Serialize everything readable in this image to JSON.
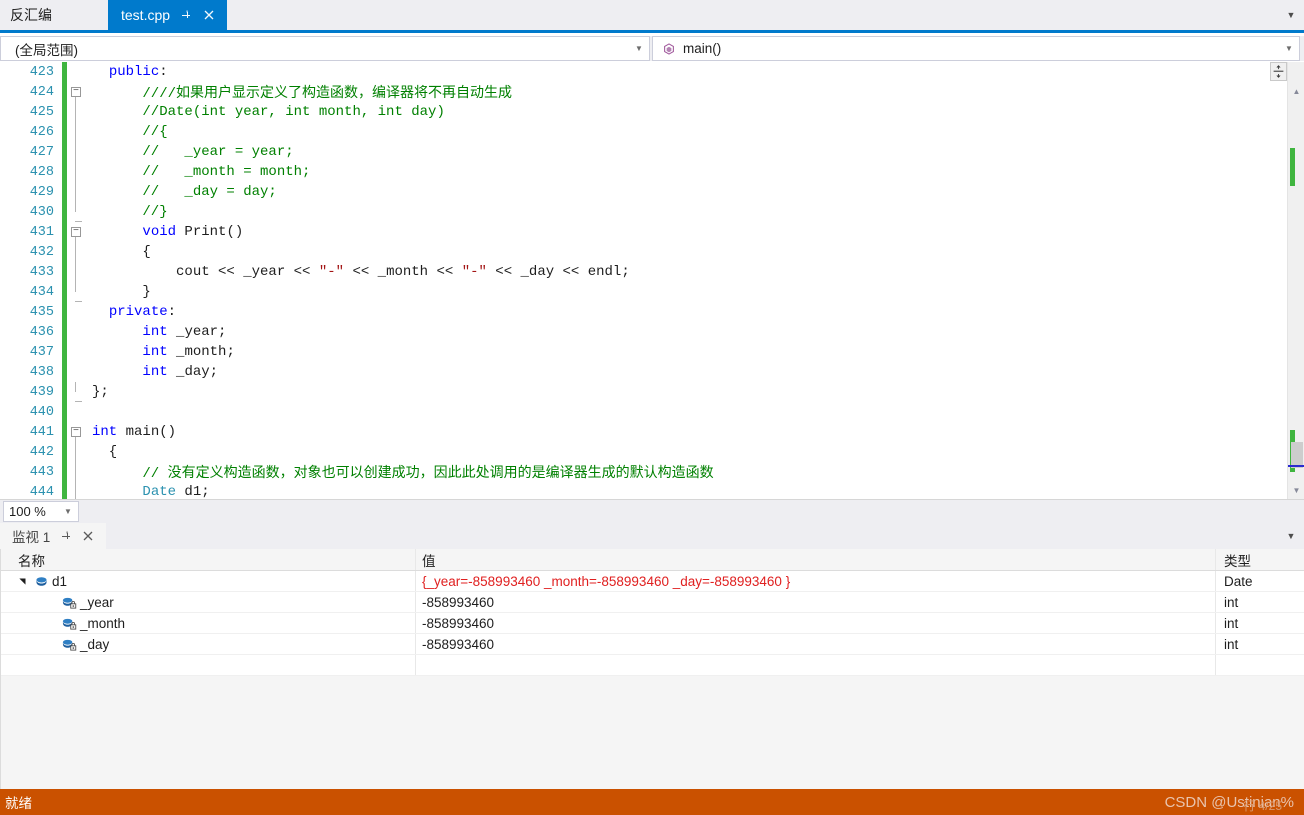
{
  "tabs": {
    "inactive_label": "反汇编",
    "active_label": "test.cpp",
    "pin_icon": "pin-icon",
    "close_icon": "close-icon",
    "overflow_icon": "chevron-down-icon"
  },
  "navbar": {
    "scope_value": "(全局范围)",
    "member_value": "main()",
    "member_icon": "method-icon",
    "caret_icon": "chevron-down-icon"
  },
  "editor": {
    "lines": [
      {
        "num": "423",
        "changed": true,
        "fold": "none",
        "segs": [
          {
            "t": "  ",
            "c": ""
          },
          {
            "t": "public",
            "c": "kw"
          },
          {
            "t": ":",
            "c": ""
          }
        ]
      },
      {
        "num": "424",
        "changed": true,
        "fold": "minus-start",
        "segs": [
          {
            "t": "      ////如果用户显示定义了构造函数，编译器将不再自动生成",
            "c": "cmt"
          }
        ]
      },
      {
        "num": "425",
        "changed": true,
        "fold": "line",
        "segs": [
          {
            "t": "      //Date(int year, int month, int day)",
            "c": "cmt"
          }
        ]
      },
      {
        "num": "426",
        "changed": true,
        "fold": "line",
        "segs": [
          {
            "t": "      //{",
            "c": "cmt"
          }
        ]
      },
      {
        "num": "427",
        "changed": true,
        "fold": "line",
        "segs": [
          {
            "t": "      //   _year = year;",
            "c": "cmt"
          }
        ]
      },
      {
        "num": "428",
        "changed": true,
        "fold": "line",
        "segs": [
          {
            "t": "      //   _month = month;",
            "c": "cmt"
          }
        ]
      },
      {
        "num": "429",
        "changed": true,
        "fold": "line",
        "segs": [
          {
            "t": "      //   _day = day;",
            "c": "cmt"
          }
        ]
      },
      {
        "num": "430",
        "changed": true,
        "fold": "line-end",
        "segs": [
          {
            "t": "      //}",
            "c": "cmt"
          }
        ]
      },
      {
        "num": "431",
        "changed": true,
        "fold": "minus-start",
        "segs": [
          {
            "t": "      ",
            "c": ""
          },
          {
            "t": "void",
            "c": "kw"
          },
          {
            "t": " Print()",
            "c": ""
          }
        ]
      },
      {
        "num": "432",
        "changed": true,
        "fold": "line",
        "segs": [
          {
            "t": "      {",
            "c": ""
          }
        ]
      },
      {
        "num": "433",
        "changed": true,
        "fold": "line",
        "segs": [
          {
            "t": "          cout << _year << ",
            "c": ""
          },
          {
            "t": "\"-\"",
            "c": "str"
          },
          {
            "t": " << _month << ",
            "c": ""
          },
          {
            "t": "\"-\"",
            "c": "str"
          },
          {
            "t": " << _day << endl;",
            "c": ""
          }
        ]
      },
      {
        "num": "434",
        "changed": true,
        "fold": "line-end",
        "segs": [
          {
            "t": "      }",
            "c": ""
          }
        ]
      },
      {
        "num": "435",
        "changed": true,
        "fold": "none",
        "segs": [
          {
            "t": "  ",
            "c": ""
          },
          {
            "t": "private",
            "c": "kw"
          },
          {
            "t": ":",
            "c": ""
          }
        ]
      },
      {
        "num": "436",
        "changed": true,
        "fold": "none",
        "segs": [
          {
            "t": "      ",
            "c": ""
          },
          {
            "t": "int",
            "c": "kw"
          },
          {
            "t": " _year;",
            "c": ""
          }
        ]
      },
      {
        "num": "437",
        "changed": true,
        "fold": "none",
        "segs": [
          {
            "t": "      ",
            "c": ""
          },
          {
            "t": "int",
            "c": "kw"
          },
          {
            "t": " _month;",
            "c": ""
          }
        ]
      },
      {
        "num": "438",
        "changed": true,
        "fold": "none",
        "segs": [
          {
            "t": "      ",
            "c": ""
          },
          {
            "t": "int",
            "c": "kw"
          },
          {
            "t": " _day;",
            "c": ""
          }
        ]
      },
      {
        "num": "439",
        "changed": true,
        "fold": "close-end",
        "segs": [
          {
            "t": "};",
            "c": ""
          }
        ]
      },
      {
        "num": "440",
        "changed": true,
        "fold": "none",
        "segs": [
          {
            "t": "",
            "c": ""
          }
        ]
      },
      {
        "num": "441",
        "changed": true,
        "fold": "minus-start",
        "segs": [
          {
            "t": "",
            "c": ""
          },
          {
            "t": "int",
            "c": "kw"
          },
          {
            "t": " main()",
            "c": ""
          }
        ]
      },
      {
        "num": "442",
        "changed": true,
        "fold": "line",
        "segs": [
          {
            "t": "  {",
            "c": ""
          }
        ]
      },
      {
        "num": "443",
        "changed": true,
        "fold": "line",
        "segs": [
          {
            "t": "      // 没有定义构造函数，对象也可以创建成功，因此此处调用的是编译器生成的默认构造函数",
            "c": "cmt"
          }
        ]
      },
      {
        "num": "444",
        "changed": true,
        "fold": "line",
        "segs": [
          {
            "t": "      ",
            "c": ""
          },
          {
            "t": "Date",
            "c": "typ"
          },
          {
            "t": " d1;",
            "c": ""
          }
        ]
      }
    ],
    "scrollbar": {
      "split_icon": "split-view-icon",
      "up_icon": "triangle-up-icon",
      "down_icon": "triangle-down-icon"
    }
  },
  "zoombar": {
    "zoom_value": "100 %",
    "caret_icon": "chevron-down-icon"
  },
  "watch": {
    "title": "监视 1",
    "pin_icon": "pin-icon",
    "close_icon": "close-icon",
    "overflow_icon": "chevron-down-icon",
    "columns": {
      "name": "名称",
      "value": "值",
      "type": "类型"
    },
    "rows": [
      {
        "name": "d1",
        "value": "{_year=-858993460 _month=-858993460 _day=-858993460 }",
        "type": "Date",
        "level": 0,
        "expanded": true,
        "icon": "object-field-icon",
        "value_style": "struct"
      },
      {
        "name": "_year",
        "value": "-858993460",
        "type": "int",
        "level": 1,
        "expanded": false,
        "icon": "private-field-icon",
        "value_style": "plain"
      },
      {
        "name": "_month",
        "value": "-858993460",
        "type": "int",
        "level": 1,
        "expanded": false,
        "icon": "private-field-icon",
        "value_style": "plain"
      },
      {
        "name": "_day",
        "value": "-858993460",
        "type": "int",
        "level": 1,
        "expanded": false,
        "icon": "private-field-icon",
        "value_style": "plain"
      }
    ]
  },
  "status": {
    "text": "就绪",
    "watermark": "CSDN @Ustinian%",
    "rowcol": "行 4/25",
    "bg_color": "#ca5100"
  }
}
